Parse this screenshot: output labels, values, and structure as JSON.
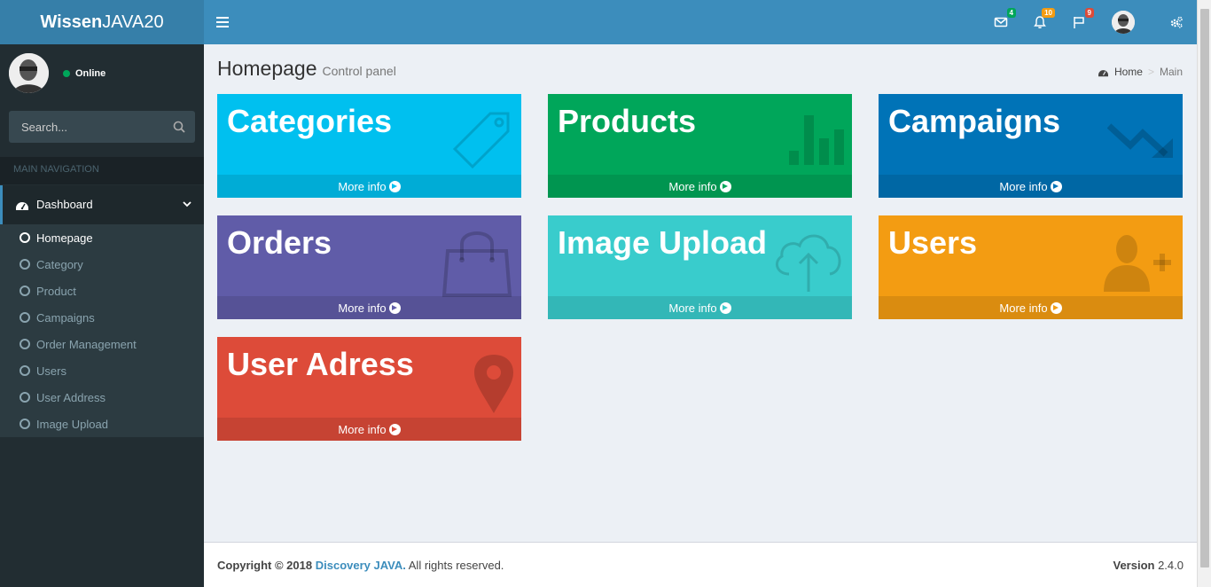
{
  "app": {
    "brand_bold": "Wissen",
    "brand_rest": "JAVA20"
  },
  "navbar": {
    "messages_count": "4",
    "notifications_count": "10",
    "tasks_count": "9",
    "colors": {
      "messages": "#00a65a",
      "notifications": "#f39c12",
      "tasks": "#dd4b39"
    }
  },
  "sidebar": {
    "status": "Online",
    "search_placeholder": "Search...",
    "header": "MAIN NAVIGATION",
    "dashboard_label": "Dashboard",
    "items": [
      "Homepage",
      "Category",
      "Product",
      "Campaigns",
      "Order Management",
      "Users",
      "User Address",
      "Image Upload"
    ]
  },
  "content": {
    "title": "Homepage",
    "subtitle": "Control panel"
  },
  "breadcrumb": {
    "home": "Home",
    "current": "Main"
  },
  "boxes": [
    {
      "title": "Categories",
      "more": "More info",
      "color": "#00c0ef",
      "icon": "tag-icon"
    },
    {
      "title": "Products",
      "more": "More info",
      "color": "#00a65a",
      "icon": "bar-chart-icon"
    },
    {
      "title": "Campaigns",
      "more": "More info",
      "color": "#0073b7",
      "icon": "trend-down-icon"
    },
    {
      "title": "Orders",
      "more": "More info",
      "color": "#605ca8",
      "icon": "shopping-bag-icon"
    },
    {
      "title": "Image Upload",
      "more": "More info",
      "color": "#39cccc",
      "icon": "cloud-upload-icon"
    },
    {
      "title": "Users",
      "more": "More info",
      "color": "#f39c12",
      "icon": "user-plus-icon"
    },
    {
      "title": "User Adress",
      "more": "More info",
      "color": "#dd4b39",
      "icon": "map-marker-icon"
    }
  ],
  "footer": {
    "copyright": "Copyright © 2018",
    "link": "Discovery JAVA.",
    "rights": "All rights reserved.",
    "version_label": "Version",
    "version": "2.4.0"
  }
}
